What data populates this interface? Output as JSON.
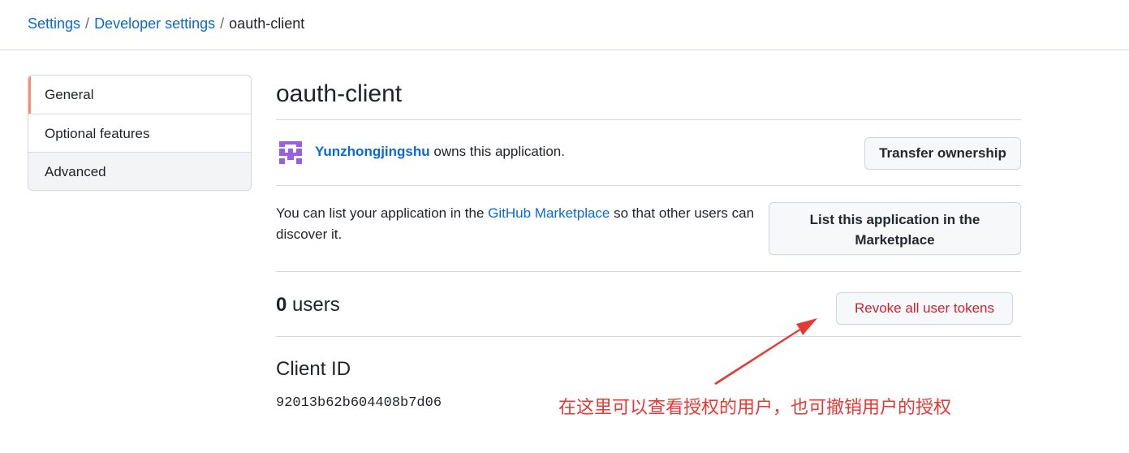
{
  "breadcrumb": {
    "items": [
      "Settings",
      "Developer settings"
    ],
    "separator": "/",
    "current": "oauth-client"
  },
  "sidebar": {
    "items": [
      {
        "label": "General",
        "selected": true
      },
      {
        "label": "Optional features",
        "selected": false
      },
      {
        "label": "Advanced",
        "selected": false
      }
    ]
  },
  "main": {
    "title": "oauth-client",
    "owner": {
      "name": "Yunzhongjingshu",
      "suffix": " owns this application.",
      "avatar_icon": "identicon-avatar",
      "avatar_color": "#9b5de5"
    },
    "transfer_button": "Transfer ownership",
    "marketplace": {
      "text_before": "You can list your application in the ",
      "link": "GitHub Marketplace",
      "text_after": " so that other users can discover it.",
      "button": "List this application in the Marketplace"
    },
    "users": {
      "count": "0",
      "label": " users",
      "revoke_button": "Revoke all user tokens"
    },
    "client_id": {
      "label": "Client ID",
      "value": "92013b62b604408b7d06"
    }
  },
  "annotation": {
    "text": "在这里可以查看授权的用户，也可撤销用户的授权",
    "color": "#e53935"
  },
  "colors": {
    "link": "#0969da",
    "danger": "#cf222e",
    "selected_marker": "#fd8c73",
    "border": "#d0d7de"
  }
}
